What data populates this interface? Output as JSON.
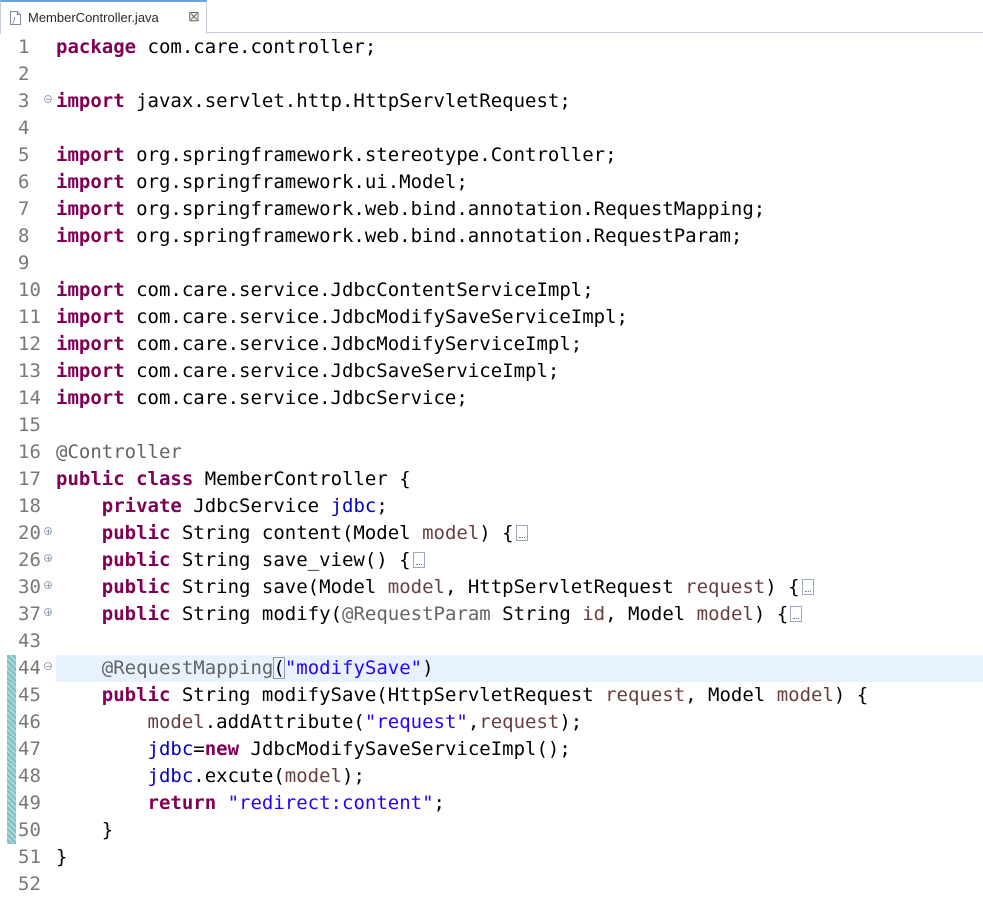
{
  "tab": {
    "label": "MemberController.java",
    "icon": "java-file-icon",
    "close_glyph": "⊠"
  },
  "fold": {
    "expanded_glyph": "−",
    "collapsed_glyph": "+"
  },
  "lines": [
    {
      "n": "1",
      "code": "package com.care.controller;"
    },
    {
      "n": "2",
      "code": ""
    },
    {
      "n": "3",
      "code": "import javax.servlet.http.HttpServletRequest;"
    },
    {
      "n": "4",
      "code": ""
    },
    {
      "n": "5",
      "code": "import org.springframework.stereotype.Controller;"
    },
    {
      "n": "6",
      "code": "import org.springframework.ui.Model;"
    },
    {
      "n": "7",
      "code": "import org.springframework.web.bind.annotation.RequestMapping;"
    },
    {
      "n": "8",
      "code": "import org.springframework.web.bind.annotation.RequestParam;"
    },
    {
      "n": "9",
      "code": ""
    },
    {
      "n": "10",
      "code": "import com.care.service.JdbcContentServiceImpl;"
    },
    {
      "n": "11",
      "code": "import com.care.service.JdbcModifySaveServiceImpl;"
    },
    {
      "n": "12",
      "code": "import com.care.service.JdbcModifyServiceImpl;"
    },
    {
      "n": "13",
      "code": "import com.care.service.JdbcSaveServiceImpl;"
    },
    {
      "n": "14",
      "code": "import com.care.service.JdbcService;"
    },
    {
      "n": "15",
      "code": ""
    },
    {
      "n": "16",
      "code": "@Controller"
    },
    {
      "n": "17",
      "code": "public class MemberController {"
    },
    {
      "n": "18",
      "code": "    private JdbcService jdbc;"
    },
    {
      "n": "20",
      "code": "    public String content(Model model) {"
    },
    {
      "n": "26",
      "code": "    public String save_view() {"
    },
    {
      "n": "30",
      "code": "    public String save(Model model, HttpServletRequest request) {"
    },
    {
      "n": "37",
      "code": "    public String modify(@RequestParam String id, Model model) {"
    },
    {
      "n": "43",
      "code": ""
    },
    {
      "n": "44",
      "code": "    @RequestMapping(\"modifySave\")"
    },
    {
      "n": "45",
      "code": "    public String modifySave(HttpServletRequest request, Model model) {"
    },
    {
      "n": "46",
      "code": "        model.addAttribute(\"request\",request);"
    },
    {
      "n": "47",
      "code": "        jdbc=new JdbcModifySaveServiceImpl();"
    },
    {
      "n": "48",
      "code": "        jdbc.excute(model);"
    },
    {
      "n": "49",
      "code": "        return \"redirect:content\";"
    },
    {
      "n": "50",
      "code": "    }"
    },
    {
      "n": "51",
      "code": "}"
    },
    {
      "n": "52",
      "code": ""
    }
  ]
}
